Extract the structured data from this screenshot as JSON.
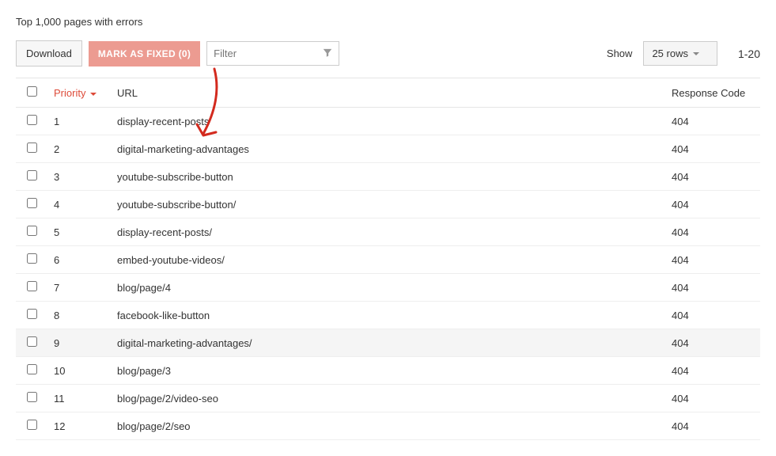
{
  "header": {
    "title": "Top 1,000 pages with errors"
  },
  "toolbar": {
    "download_label": "Download",
    "mark_fixed_label": "MARK AS FIXED (0)",
    "filter_placeholder": "Filter",
    "show_label": "Show",
    "rows_selector": "25 rows",
    "range": "1-20"
  },
  "table": {
    "headers": {
      "priority": "Priority",
      "url": "URL",
      "response_code": "Response Code"
    },
    "rows": [
      {
        "priority": "1",
        "url": "display-recent-posts",
        "code": "404",
        "highlight": false
      },
      {
        "priority": "2",
        "url": "digital-marketing-advantages",
        "code": "404",
        "highlight": false
      },
      {
        "priority": "3",
        "url": "youtube-subscribe-button",
        "code": "404",
        "highlight": false
      },
      {
        "priority": "4",
        "url": "youtube-subscribe-button/",
        "code": "404",
        "highlight": false
      },
      {
        "priority": "5",
        "url": "display-recent-posts/",
        "code": "404",
        "highlight": false
      },
      {
        "priority": "6",
        "url": "embed-youtube-videos/",
        "code": "404",
        "highlight": false
      },
      {
        "priority": "7",
        "url": "blog/page/4",
        "code": "404",
        "highlight": false
      },
      {
        "priority": "8",
        "url": "facebook-like-button",
        "code": "404",
        "highlight": false
      },
      {
        "priority": "9",
        "url": "digital-marketing-advantages/",
        "code": "404",
        "highlight": true
      },
      {
        "priority": "10",
        "url": "blog/page/3",
        "code": "404",
        "highlight": false
      },
      {
        "priority": "11",
        "url": "blog/page/2/video-seo",
        "code": "404",
        "highlight": false
      },
      {
        "priority": "12",
        "url": "blog/page/2/seo",
        "code": "404",
        "highlight": false
      }
    ]
  }
}
